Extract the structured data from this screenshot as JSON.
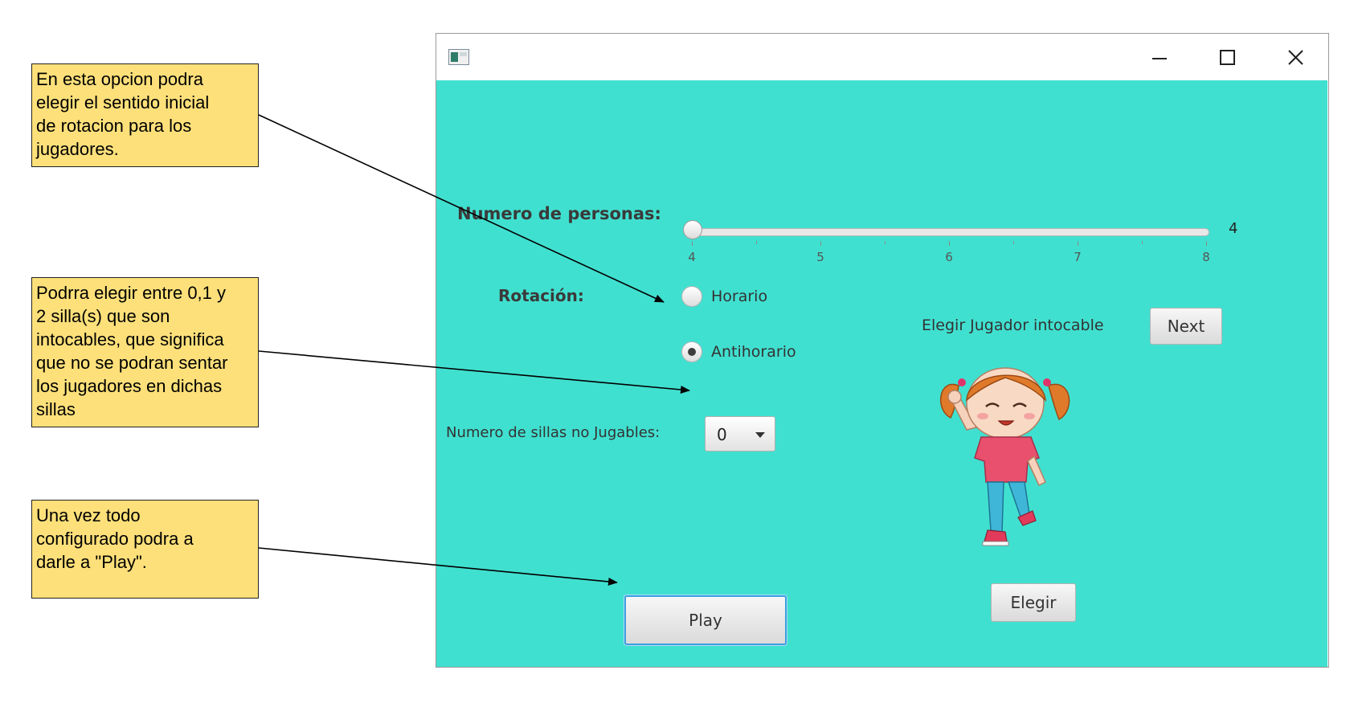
{
  "annotations": {
    "note1": "En esta opcion podra\nelegir el sentido inicial\nde rotacion para  los\njugadores.",
    "note2": "Podrra elegir entre 0,1 y\n2 silla(s) que son\nintocables, que significa\nque no se podran sentar\nlos jugadores en dichas\nsillas",
    "note3": "Una vez todo\nconfigurado podra a\ndarle  a \"Play\"."
  },
  "window": {
    "controls": {
      "minimize": "minimize-icon",
      "maximize": "maximize-icon",
      "close": "close-icon"
    },
    "background_color": "#40e0d0"
  },
  "form": {
    "people_label": "Numero de personas:",
    "slider": {
      "min": 4,
      "max": 8,
      "value": 4,
      "value_label": "4",
      "tick_labels": [
        "4",
        "5",
        "6",
        "7",
        "8"
      ]
    },
    "rotation_label": "Rotación:",
    "rotation_options": [
      {
        "label": "Horario",
        "selected": false
      },
      {
        "label": "Antihorario",
        "selected": true
      }
    ],
    "chairs_label": "Numero de sillas no Jugables:",
    "chairs_value": "0",
    "play_button": "Play"
  },
  "player_panel": {
    "title": "Elegir Jugador intocable",
    "next_button": "Next",
    "choose_button": "Elegir",
    "character_icon": "girl-character-icon"
  }
}
